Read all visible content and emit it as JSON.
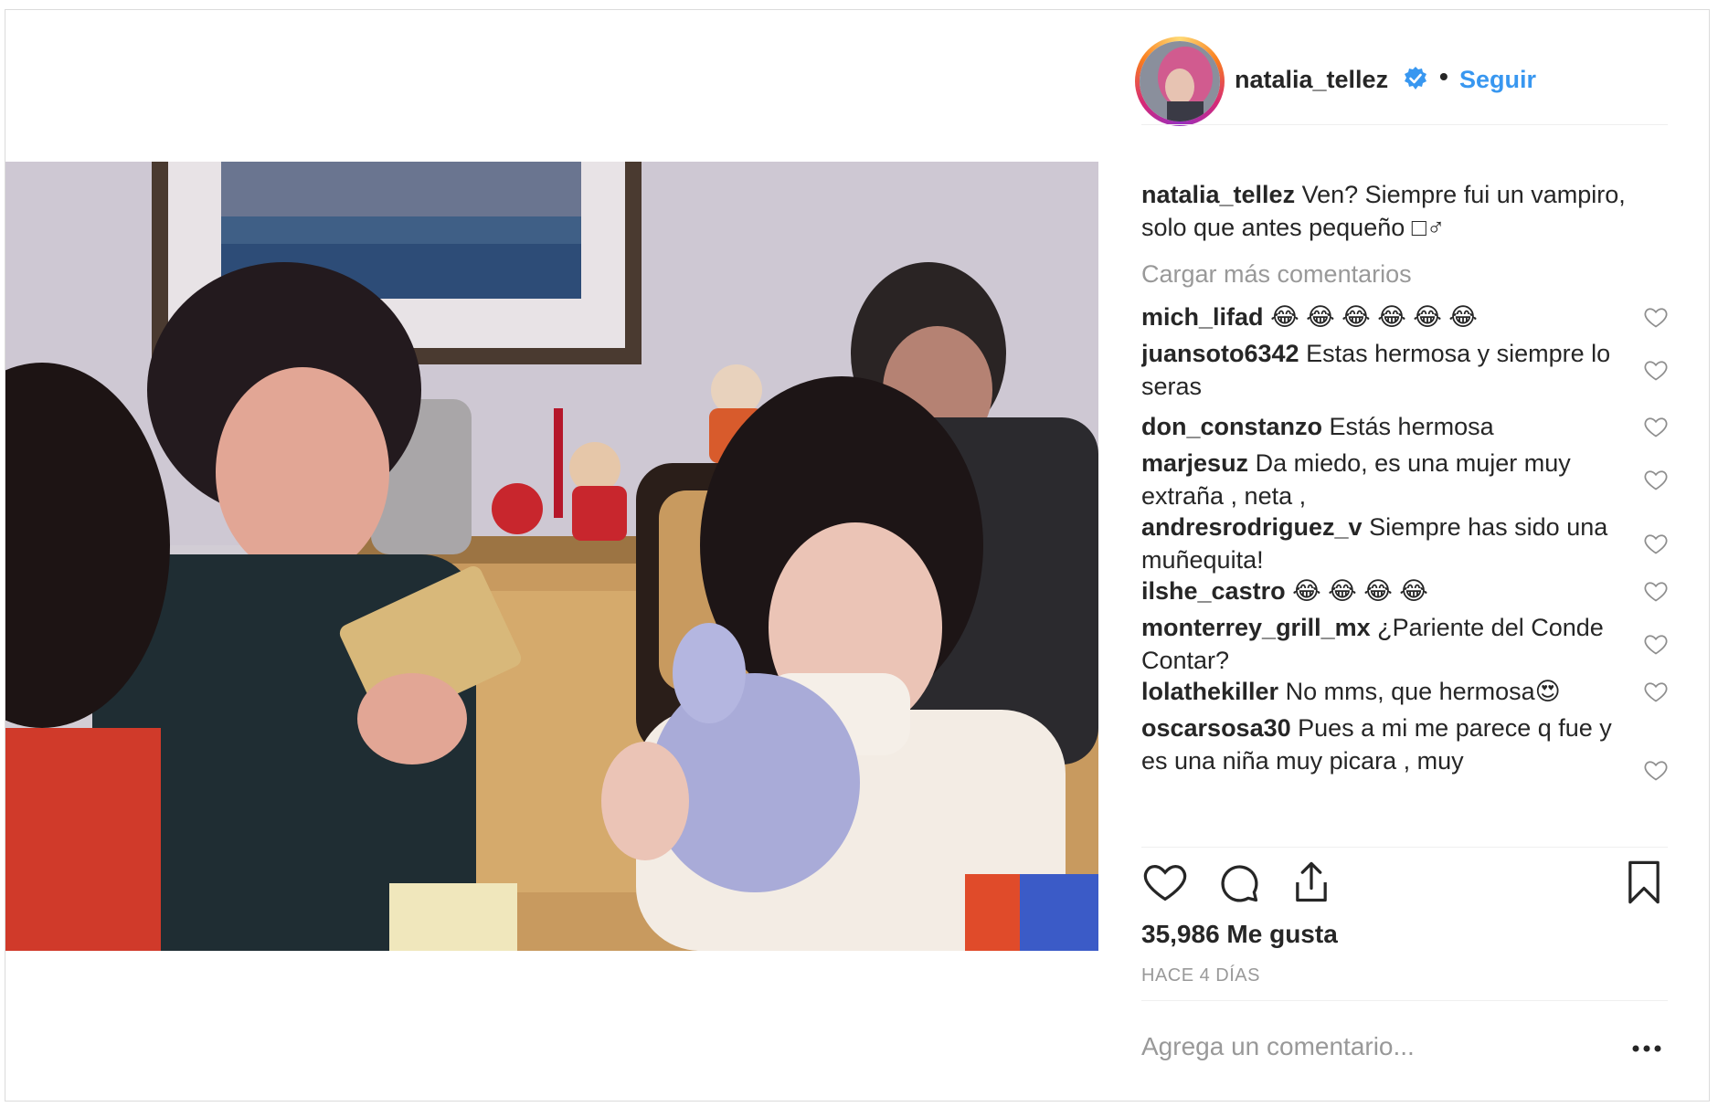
{
  "post": {
    "username": "natalia_tellez",
    "verified_icon": "verified-badge-icon",
    "separator": "•",
    "follow_label": "Seguir",
    "accent_color": "#3897f0",
    "caption_user": "natalia_tellez",
    "caption_text": "Ven? Siempre fui un vampiro, solo que antes pequeño □♂",
    "load_more_label": "Cargar más comentarios",
    "likes_text": "35,986 Me gusta",
    "time_text": "HACE 4 DÍAS",
    "add_comment_placeholder": "Agrega un comentario...",
    "more_icon": "more-options-icon"
  },
  "comments": [
    {
      "user": "mich_lifad",
      "text": "",
      "emoji": "😂",
      "emoji_count": 6
    },
    {
      "user": "juansoto6342",
      "text": "Estas hermosa y siempre lo seras"
    },
    {
      "user": "don_constanzo",
      "text": "Estás hermosa"
    },
    {
      "user": "marjesuz",
      "text": "Da miedo, es una mujer muy extraña , neta ,"
    },
    {
      "user": "andresrodriguez_v",
      "text": "Siempre has sido una muñequita!"
    },
    {
      "user": "ilshe_castro",
      "text": "",
      "emoji": "😂",
      "emoji_count": 4
    },
    {
      "user": "monterrey_grill_mx",
      "text": "¿Pariente del Conde Contar?"
    },
    {
      "user": "lolathekiller",
      "text": "No mms, que hermosa😍"
    },
    {
      "user": "oscarsosa30",
      "text": "Pues a mi me parece q fue y es una niña muy picara , muy"
    }
  ],
  "actions": {
    "like_icon": "heart-icon",
    "comment_icon": "comment-icon",
    "share_icon": "share-icon",
    "save_icon": "bookmark-icon"
  }
}
